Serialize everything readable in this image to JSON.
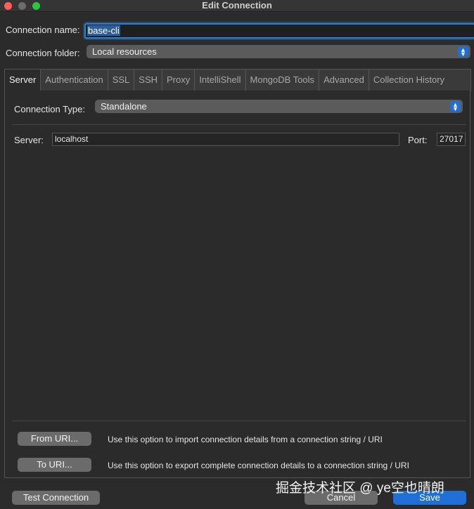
{
  "window": {
    "title": "Edit Connection"
  },
  "connection_name": {
    "label": "Connection name:",
    "value": "base-cli"
  },
  "connection_folder": {
    "label": "Connection folder:",
    "value": "Local resources"
  },
  "tabs": [
    {
      "label": "Server",
      "active": true
    },
    {
      "label": "Authentication"
    },
    {
      "label": "SSL"
    },
    {
      "label": "SSH"
    },
    {
      "label": "Proxy"
    },
    {
      "label": "IntelliShell"
    },
    {
      "label": "MongoDB Tools"
    },
    {
      "label": "Advanced"
    },
    {
      "label": "Collection History"
    }
  ],
  "server_tab": {
    "connection_type": {
      "label": "Connection Type:",
      "value": "Standalone"
    },
    "server": {
      "label": "Server:",
      "value": "localhost"
    },
    "port": {
      "label": "Port:",
      "value": "27017"
    }
  },
  "uri": {
    "from": {
      "button": "From URI...",
      "hint": "Use this option to import connection details from a connection string / URI"
    },
    "to": {
      "button": "To URI...",
      "hint": "Use this option to export complete connection details to a connection string / URI"
    }
  },
  "footer": {
    "test_button": "Test Connection",
    "cancel_button": "Cancel",
    "save_button": "Save"
  },
  "watermark": "掘金技术社区 @ ye空也晴朗",
  "colors": {
    "accent": "#1f6fd6",
    "close": "#fe5f57",
    "zoom": "#28c840"
  }
}
